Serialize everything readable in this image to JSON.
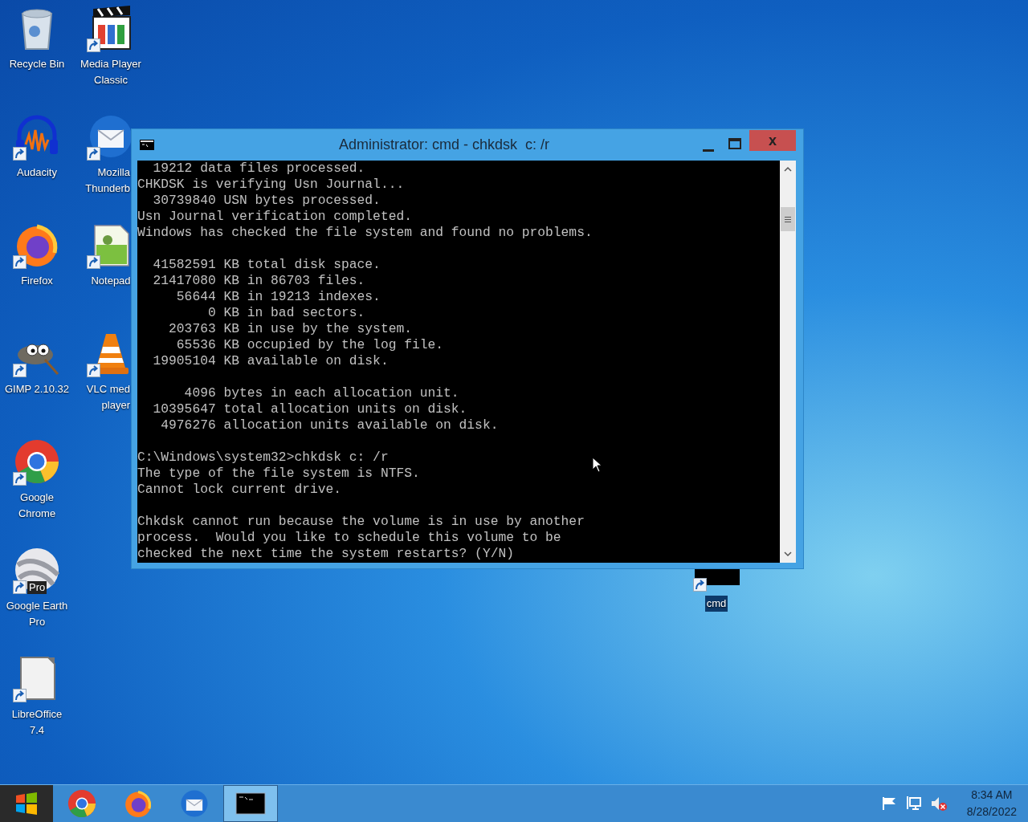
{
  "desktop_icons": [
    {
      "kind": "recycle-bin",
      "lines": [
        "Recycle Bin"
      ],
      "shortcut": false,
      "cut_by_window": false,
      "selected": false
    },
    {
      "kind": "media-player",
      "lines": [
        "Media Player",
        "Classic"
      ],
      "shortcut": true,
      "cut_by_window": false,
      "selected": false
    },
    {
      "kind": "audacity",
      "lines": [
        "Audacity"
      ],
      "shortcut": true,
      "cut_by_window": false,
      "selected": false
    },
    {
      "kind": "thunderbird",
      "lines": [
        "Mozilla",
        "Thunderb"
      ],
      "shortcut": true,
      "cut_by_window": true,
      "selected": false
    },
    {
      "kind": "firefox",
      "lines": [
        "Firefox"
      ],
      "shortcut": true,
      "cut_by_window": false,
      "selected": false
    },
    {
      "kind": "notepad",
      "lines": [
        "Notepad"
      ],
      "shortcut": true,
      "cut_by_window": false,
      "selected": false
    },
    {
      "kind": "gimp",
      "lines": [
        "GIMP 2.10.32"
      ],
      "shortcut": true,
      "cut_by_window": false,
      "selected": false
    },
    {
      "kind": "vlc",
      "lines": [
        "VLC med",
        "player"
      ],
      "shortcut": true,
      "cut_by_window": true,
      "selected": false
    },
    {
      "kind": "chrome",
      "lines": [
        "Google",
        "Chrome"
      ],
      "shortcut": true,
      "cut_by_window": false,
      "selected": false
    },
    {
      "kind": "earth",
      "lines": [
        "Google Earth",
        "Pro"
      ],
      "badge": "Pro",
      "shortcut": true,
      "cut_by_window": false,
      "selected": false
    },
    {
      "kind": "libreoffice",
      "lines": [
        "LibreOffice",
        "7.4"
      ],
      "shortcut": true,
      "cut_by_window": false,
      "selected": false
    },
    {
      "kind": "cmd",
      "lines": [
        "cmd"
      ],
      "shortcut": true,
      "cut_by_window": false,
      "selected": true
    }
  ],
  "window": {
    "title": "Administrator: cmd - chkdsk  c: /r",
    "close": "x",
    "console_blocks": [
      [
        "  19212 data files processed.",
        "CHKDSK is verifying Usn Journal...",
        "  30739840 USN bytes processed.",
        "Usn Journal verification completed.",
        "Windows has checked the file system and found no problems."
      ],
      [
        "  41582591 KB total disk space.",
        "  21417080 KB in 86703 files.",
        "     56644 KB in 19213 indexes.",
        "         0 KB in bad sectors.",
        "    203763 KB in use by the system.",
        "     65536 KB occupied by the log file.",
        "  19905104 KB available on disk."
      ],
      [
        "      4096 bytes in each allocation unit.",
        "  10395647 total allocation units on disk.",
        "   4976276 allocation units available on disk."
      ],
      [
        "C:\\Windows\\system32>chkdsk c: /r",
        "The type of the file system is NTFS.",
        "Cannot lock current drive."
      ],
      [
        "Chkdsk cannot run because the volume is in use by another",
        "process.  Would you like to schedule this volume to be",
        "checked the next time the system restarts? (Y/N)"
      ]
    ]
  },
  "taskbar": {
    "apps": [
      {
        "kind": "chrome",
        "selected": false
      },
      {
        "kind": "firefox",
        "selected": false
      },
      {
        "kind": "thunderbird",
        "selected": false
      },
      {
        "kind": "cmd",
        "selected": true
      }
    ],
    "clock": {
      "time": "8:34 AM",
      "date": "8/28/2022"
    }
  }
}
